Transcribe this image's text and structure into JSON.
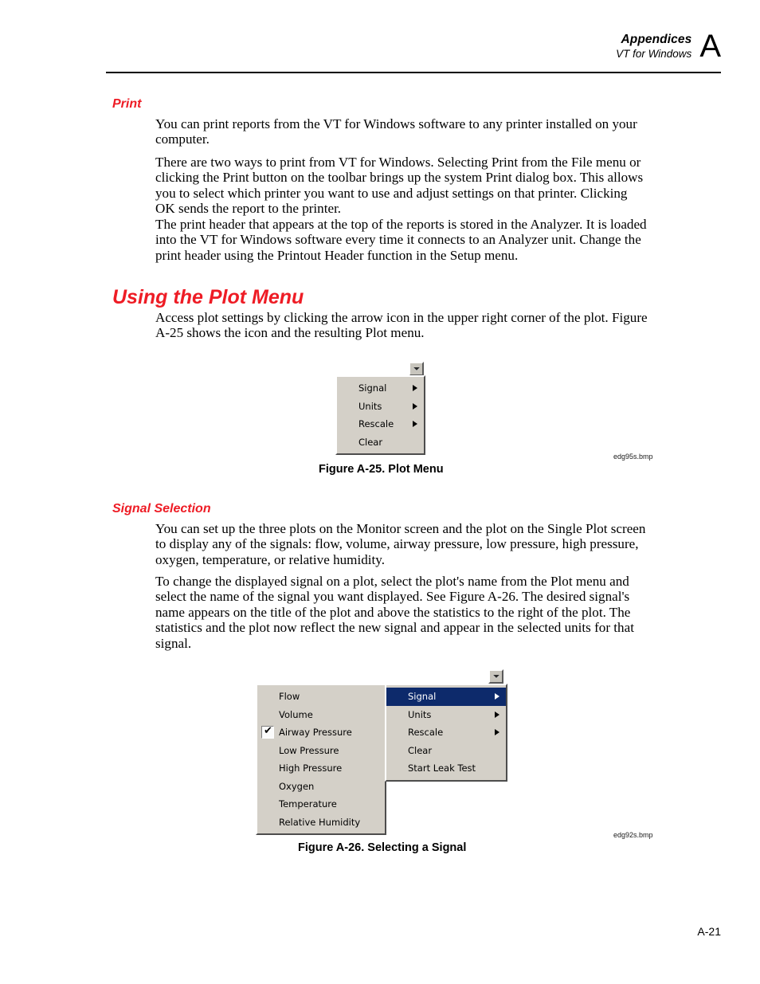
{
  "header": {
    "title": "Appendices",
    "subtitle": "VT for Windows",
    "letter": "A"
  },
  "sections": {
    "print": {
      "heading": "Print",
      "paragraphs": [
        "You can print reports from the VT for Windows software to any printer installed on your computer.",
        "There are two ways to print from VT for Windows. Selecting Print from the File menu or clicking the Print button on the toolbar brings up the system Print dialog box. This allows you to select which printer you want to use and adjust settings on that printer. Clicking OK sends the report to the printer.",
        "The print header that appears at the top of the reports is stored in the Analyzer. It is loaded into the VT for Windows software every time it connects to an Analyzer unit. Change the print header using the Printout Header function in the Setup menu."
      ]
    },
    "using_plot_menu": {
      "heading": "Using the Plot Menu",
      "paragraphs": [
        "Access plot settings by clicking the arrow icon in the upper right corner of the plot. Figure A-25 shows the icon and the resulting Plot menu."
      ]
    },
    "signal_selection": {
      "heading": "Signal Selection",
      "paragraphs": [
        "You can set up the three plots on the Monitor screen and the plot on the Single Plot screen to display any of the signals: flow, volume, airway pressure, low pressure, high pressure, oxygen, temperature, or relative humidity.",
        "To change the displayed signal on a plot, select the plot's name from the Plot menu and select the name of the signal you want displayed. See Figure A-26. The desired signal's name appears on the title of the plot and above the statistics to the right of the plot. The statistics and the plot now reflect the new signal and appear in the selected units for that signal."
      ]
    }
  },
  "figure_25": {
    "caption": "Figure A-25. Plot Menu",
    "bmp_label": "edg95s.bmp",
    "dropdown_icon": "chevron-down-icon",
    "menu_items": [
      {
        "label": "Signal",
        "has_submenu": true,
        "checked": false,
        "selected": false
      },
      {
        "label": "Units",
        "has_submenu": true,
        "checked": false,
        "selected": false
      },
      {
        "label": "Rescale",
        "has_submenu": true,
        "checked": false,
        "selected": false
      },
      {
        "label": "Clear",
        "has_submenu": false,
        "checked": false,
        "selected": false
      }
    ]
  },
  "figure_26": {
    "caption": "Figure A-26. Selecting a Signal",
    "bmp_label": "edg92s.bmp",
    "dropdown_icon": "chevron-down-icon",
    "plot_menu_items": [
      {
        "label": "Signal",
        "has_submenu": true,
        "checked": false,
        "selected": true
      },
      {
        "label": "Units",
        "has_submenu": true,
        "checked": false,
        "selected": false
      },
      {
        "label": "Rescale",
        "has_submenu": true,
        "checked": false,
        "selected": false
      },
      {
        "label": "Clear",
        "has_submenu": false,
        "checked": false,
        "selected": false
      },
      {
        "label": "Start Leak Test",
        "has_submenu": false,
        "checked": false,
        "selected": false
      }
    ],
    "signal_submenu_items": [
      {
        "label": "Flow",
        "has_submenu": false,
        "checked": false,
        "selected": false
      },
      {
        "label": "Volume",
        "has_submenu": false,
        "checked": false,
        "selected": false
      },
      {
        "label": "Airway Pressure",
        "has_submenu": false,
        "checked": true,
        "selected": false
      },
      {
        "label": "Low Pressure",
        "has_submenu": false,
        "checked": false,
        "selected": false
      },
      {
        "label": "High Pressure",
        "has_submenu": false,
        "checked": false,
        "selected": false
      },
      {
        "label": "Oxygen",
        "has_submenu": false,
        "checked": false,
        "selected": false
      },
      {
        "label": "Temperature",
        "has_submenu": false,
        "checked": false,
        "selected": false
      },
      {
        "label": "Relative Humidity",
        "has_submenu": false,
        "checked": false,
        "selected": false
      }
    ],
    "checkmark_glyph": "✔"
  },
  "footer": {
    "page_number": "A-21"
  },
  "colors": {
    "heading_red": "#ee1c25",
    "menu_face": "#d4d0c8",
    "menu_highlight": "#0d2a6b"
  }
}
